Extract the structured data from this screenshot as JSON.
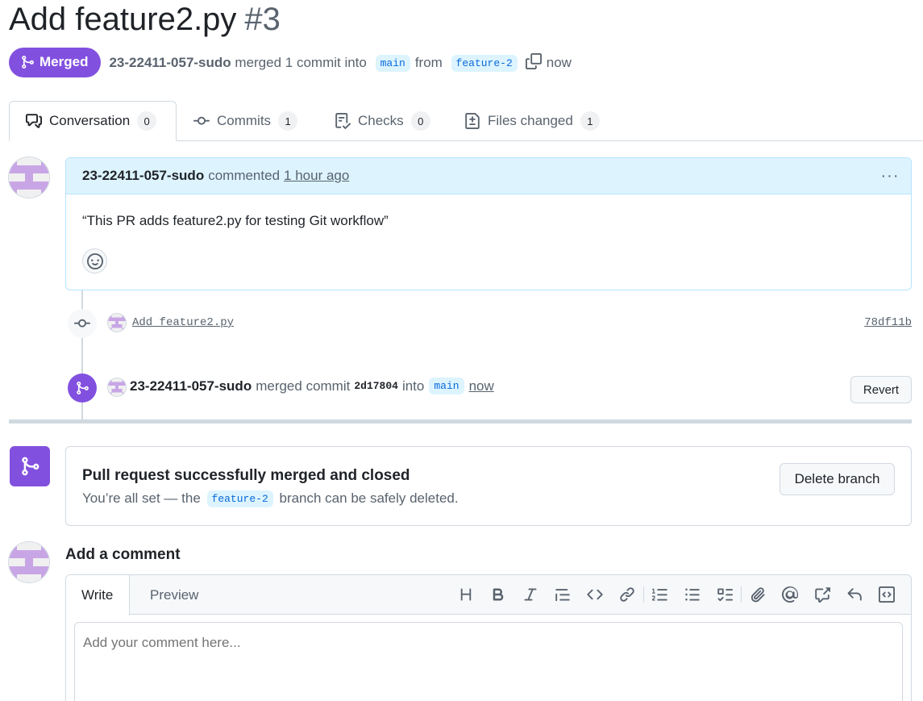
{
  "header": {
    "title": "Add feature2.py",
    "number": "#3",
    "state_label": "Merged",
    "author": "23-22411-057-sudo",
    "merged_text": "merged 1 commit into",
    "base_branch": "main",
    "from_text": "from",
    "head_branch": "feature-2",
    "time": "now"
  },
  "tabs": [
    {
      "label": "Conversation",
      "count": "0",
      "icon": "comment-discussion-icon"
    },
    {
      "label": "Commits",
      "count": "1",
      "icon": "git-commit-icon"
    },
    {
      "label": "Checks",
      "count": "0",
      "icon": "checklist-icon"
    },
    {
      "label": "Files changed",
      "count": "1",
      "icon": "file-diff-icon"
    }
  ],
  "comment": {
    "author": "23-22411-057-sudo",
    "action": "commented",
    "time": "1 hour ago",
    "body": "“This PR adds feature2.py for testing Git workflow”"
  },
  "commit": {
    "message": "Add feature2.py",
    "sha": "78df11b"
  },
  "merge_event": {
    "author": "23-22411-057-sudo",
    "text": "merged commit",
    "sha": "2d17804",
    "into": "into",
    "branch": "main",
    "time": "now",
    "revert_label": "Revert"
  },
  "merged_box": {
    "title": "Pull request successfully merged and closed",
    "desc_before": "You’re all set — the",
    "branch": "feature-2",
    "desc_after": "branch can be safely deleted.",
    "delete_label": "Delete branch"
  },
  "add_comment": {
    "title": "Add a comment",
    "write_tab": "Write",
    "preview_tab": "Preview",
    "placeholder": "Add your comment here..."
  },
  "colors": {
    "merged_purple": "#8250df",
    "link_blue": "#0969da",
    "comment_header_bg": "#ddf4ff"
  }
}
